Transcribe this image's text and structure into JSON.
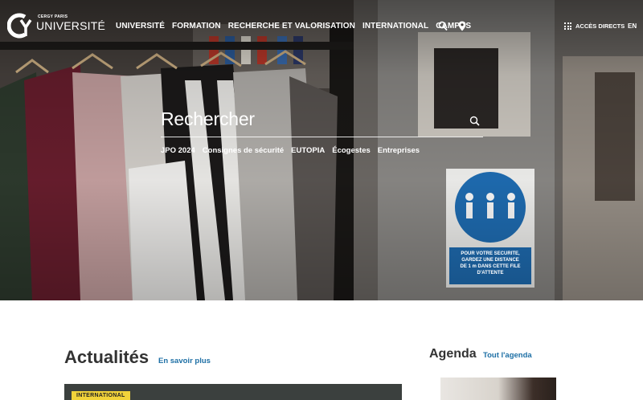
{
  "header": {
    "logo": {
      "small_text": "CERGY PARIS",
      "big_text": "UNIVERSITÉ"
    },
    "nav": [
      {
        "label": "UNIVERSITÉ"
      },
      {
        "label": "FORMATION"
      },
      {
        "label": "RECHERCHE ET VALORISATION"
      },
      {
        "label": "INTERNATIONAL"
      },
      {
        "label": "CAMPUS"
      }
    ],
    "acces_directs": "ACCÈS DIRECTS",
    "lang": "EN",
    "icons": {
      "search": "search-icon",
      "location": "map-pin-icon",
      "grid": "grid-icon"
    }
  },
  "hero": {
    "search_label": "Rechercher",
    "quick_links": [
      {
        "label": "JPO 2024"
      },
      {
        "label": "Consignes de sécurité"
      },
      {
        "label": "EUTOPIA"
      },
      {
        "label": "Écogestes"
      },
      {
        "label": "Entreprises"
      }
    ],
    "sign_text": [
      "POUR VOTRE SECURITE,",
      "GARDEZ UNE DISTANCE",
      "DE 1 m DANS CETTE FILE",
      "D'ATTENTE"
    ]
  },
  "news": {
    "title": "Actualités",
    "more_label": "En savoir plus",
    "first_tag": "INTERNATIONAL"
  },
  "agenda": {
    "title": "Agenda",
    "more_label": "Tout l'agenda"
  },
  "colors": {
    "link": "#1d6fa5",
    "tag_bg": "#f2d33a",
    "heading": "#333333",
    "sign_blue": "#1f6eb5"
  }
}
